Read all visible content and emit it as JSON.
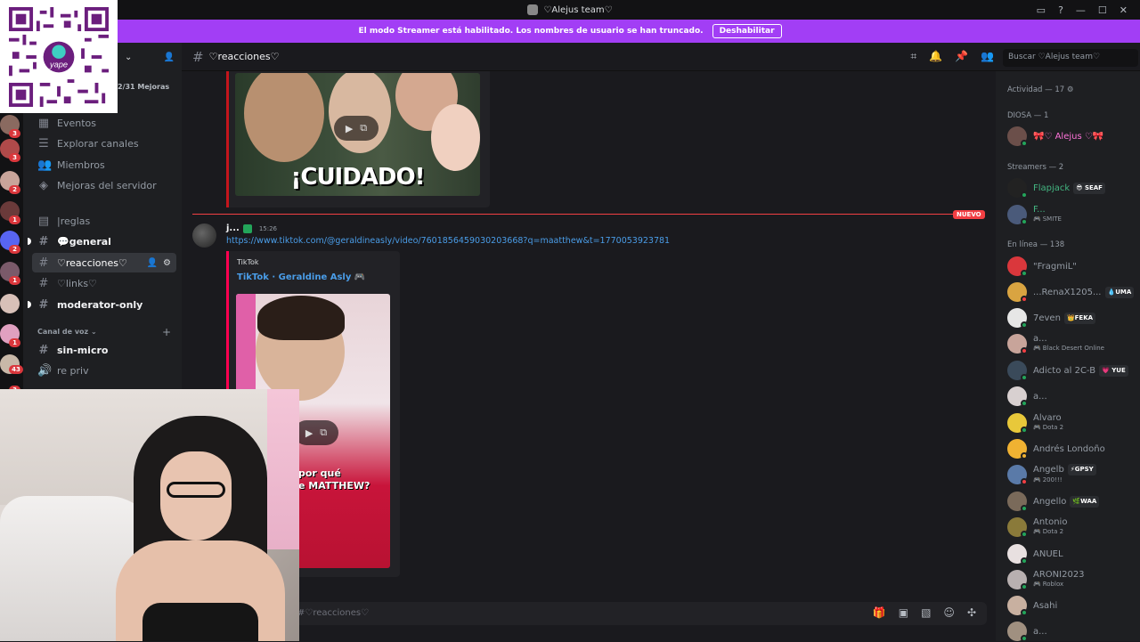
{
  "window": {
    "title": "♡Alejus team♡",
    "controls": [
      "inbox-icon",
      "help-icon",
      "minimize-icon",
      "maximize-icon",
      "close-icon"
    ]
  },
  "streamer_bar": {
    "message": "El modo Streamer está habilitado. Los nombres de usuario se han truncado.",
    "button": "Deshabilitar"
  },
  "qr": {
    "label": "yape"
  },
  "guild_badges": [
    "3",
    "3",
    "2",
    "1",
    "2",
    "1",
    "1",
    "43",
    "3"
  ],
  "sidebar": {
    "boost": "2/31 Mejoras",
    "items": [
      {
        "label": "Eventos",
        "icon": "calendar-icon"
      },
      {
        "label": "Explorar canales",
        "icon": "list-icon"
      },
      {
        "label": "Miembros",
        "icon": "members-icon"
      },
      {
        "label": "Mejoras del servidor",
        "icon": "boost-icon"
      }
    ],
    "channels": [
      {
        "label": "|reglas",
        "icon": "rules-icon"
      },
      {
        "label": "💬general",
        "icon": "hash-icon"
      },
      {
        "label": "♡reacciones♡",
        "icon": "hash-icon"
      },
      {
        "label": "♡links♡",
        "icon": "hash-icon"
      },
      {
        "label": "moderator-only",
        "icon": "hash-icon"
      }
    ],
    "voice_category": "Canal de voz",
    "voice_channels": [
      {
        "label": "sin-micro",
        "icon": "hash-icon"
      },
      {
        "label": "re priv",
        "icon": "speaker-icon"
      }
    ]
  },
  "header": {
    "channel": "♡reacciones♡",
    "search_placeholder": "Buscar ♡Alejus team♡"
  },
  "embed1": {
    "thumb_text": "¡CUIDADO!",
    "accent": "#c4151c"
  },
  "new_label": "NUEVO",
  "message": {
    "author": "j...",
    "time": "15:26",
    "link": "https://www.tiktok.com/@geraldineasly/video/7601856459030203668?q=maatthew&t=1770053923781",
    "embed_provider": "TikTok",
    "embed_title": "TikTok · Geraldine Asly 🎮",
    "thumb_caption_1": "por qué",
    "thumb_caption_2": "e MATTHEW?",
    "accent": "#ff0050"
  },
  "composer": {
    "placeholder": "#♡reacciones♡"
  },
  "members": {
    "activity": "Actividad — 17",
    "groups": [
      {
        "title": "DIOSA — 1"
      },
      {
        "title": "Streamers — 2"
      },
      {
        "title": "En línea — 138"
      }
    ],
    "list": [
      {
        "name": "🎀♡ Alejus ♡🎀",
        "activity": "",
        "tag": "",
        "color": "#ff73d9",
        "status": "online",
        "av": "#6b4f4a"
      },
      {
        "name": "Flapjack",
        "activity": "",
        "tag": "😎 SEAF",
        "color": "#43b581",
        "status": "online",
        "av": "#222222"
      },
      {
        "name": "F...",
        "activity": "SMITE",
        "tag": "",
        "color": "#43b581",
        "status": "online",
        "av": "#4a5a7a"
      },
      {
        "name": "\"FragmiL\"",
        "activity": "",
        "tag": "",
        "color": "#949ba4",
        "status": "online",
        "av": "#da373c"
      },
      {
        "name": "...RenaX1205...",
        "activity": "",
        "tag": "💧UMA",
        "color": "#949ba4",
        "status": "dnd",
        "av": "#d9a441"
      },
      {
        "name": "7even",
        "activity": "",
        "tag": "👑FEKA",
        "color": "#949ba4",
        "status": "online",
        "av": "#e6e6e6"
      },
      {
        "name": "a...",
        "activity": "Black Desert Online",
        "tag": "",
        "color": "#949ba4",
        "status": "dnd",
        "av": "#c8a49a"
      },
      {
        "name": "Adicto al 2C-B",
        "activity": "",
        "tag": "💗 YUE",
        "color": "#949ba4",
        "status": "online",
        "av": "#3a4a5a"
      },
      {
        "name": "a...",
        "activity": "",
        "tag": "",
        "color": "#949ba4",
        "status": "online",
        "av": "#d8d0d0"
      },
      {
        "name": "Alvaro",
        "activity": "Dota 2",
        "tag": "",
        "color": "#949ba4",
        "status": "online",
        "av": "#e8c83a"
      },
      {
        "name": "Andrés Londoño",
        "activity": "",
        "tag": "",
        "color": "#949ba4",
        "status": "idle",
        "av": "#f0b232"
      },
      {
        "name": "Angelb",
        "activity": "200!!!",
        "tag": "⚡GPSY",
        "color": "#949ba4",
        "status": "dnd",
        "av": "#5a7aa8"
      },
      {
        "name": "Angello",
        "activity": "",
        "tag": "🌿WAA",
        "color": "#949ba4",
        "status": "online",
        "av": "#7a6a5a"
      },
      {
        "name": "Antonio",
        "activity": "Dota 2",
        "tag": "",
        "color": "#949ba4",
        "status": "online",
        "av": "#8a7a3a"
      },
      {
        "name": "ANUEL",
        "activity": "",
        "tag": "",
        "color": "#949ba4",
        "status": "online",
        "av": "#e8e0e0"
      },
      {
        "name": "ARONI2023",
        "activity": "Roblox",
        "tag": "",
        "color": "#949ba4",
        "status": "online",
        "av": "#b8b0b0"
      },
      {
        "name": "Asahi",
        "activity": "",
        "tag": "",
        "color": "#949ba4",
        "status": "online",
        "av": "#c8b0a0"
      },
      {
        "name": "a...",
        "activity": "",
        "tag": "",
        "color": "#949ba4",
        "status": "online",
        "av": "#a09080"
      }
    ]
  }
}
